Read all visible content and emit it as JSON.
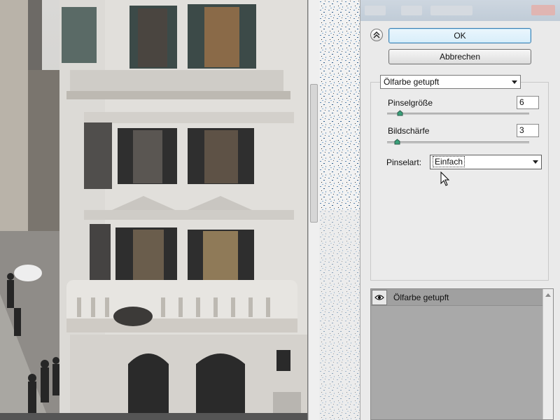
{
  "dialog": {
    "ok_label": "OK",
    "cancel_label": "Abbrechen",
    "filter_name": "Ölfarbe getupft"
  },
  "settings": {
    "brush_size": {
      "label": "Pinselgröße",
      "value": "6",
      "slider_fraction": 0.06
    },
    "sharpness": {
      "label": "Bildschärfe",
      "value": "3",
      "slider_fraction": 0.04
    },
    "brush_type": {
      "label": "Pinselart:",
      "value": "Einfach"
    }
  },
  "layers": {
    "items": [
      {
        "label": "Ölfarbe getupft",
        "visible": true
      }
    ]
  },
  "icons": {
    "collapse": "chevron-double-up-icon",
    "visibility": "eye-icon",
    "cursor": "mouse-pointer-icon"
  },
  "colors": {
    "ok_border": "#3c7fb1",
    "layers_bg": "#a9a9a9",
    "dialog_bg": "#eaeaea"
  }
}
